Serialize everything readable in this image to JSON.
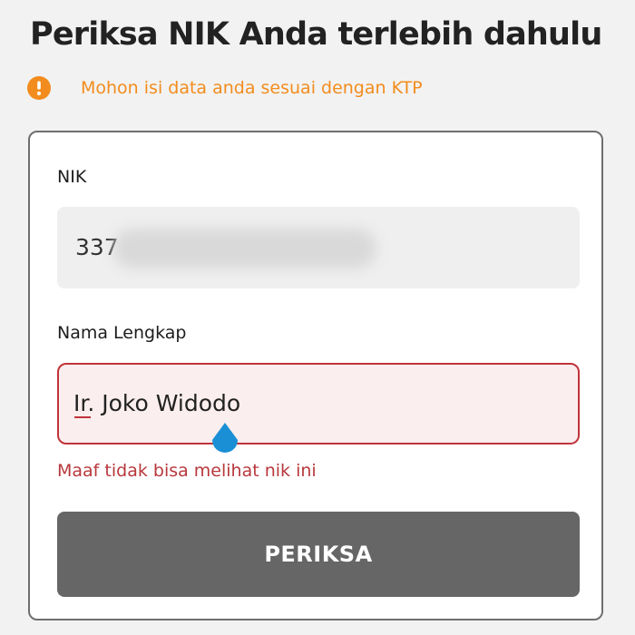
{
  "header": {
    "title": "Periksa NIK Anda terlebih dahulu"
  },
  "notice": {
    "icon": "info-icon",
    "text": "Mohon isi data anda sesuai dengan KTP",
    "color": "#f28c1e"
  },
  "form": {
    "nik": {
      "label": "NIK",
      "value": "337"
    },
    "name": {
      "label": "Nama Lengkap",
      "value": "Ir. Joko Widodo",
      "error": "Maaf tidak bisa melihat nik ini"
    },
    "submit_label": "PERIKSA"
  },
  "colors": {
    "error": "#c0343a",
    "button": "#666666",
    "cursor_handle": "#1b8fd6"
  }
}
